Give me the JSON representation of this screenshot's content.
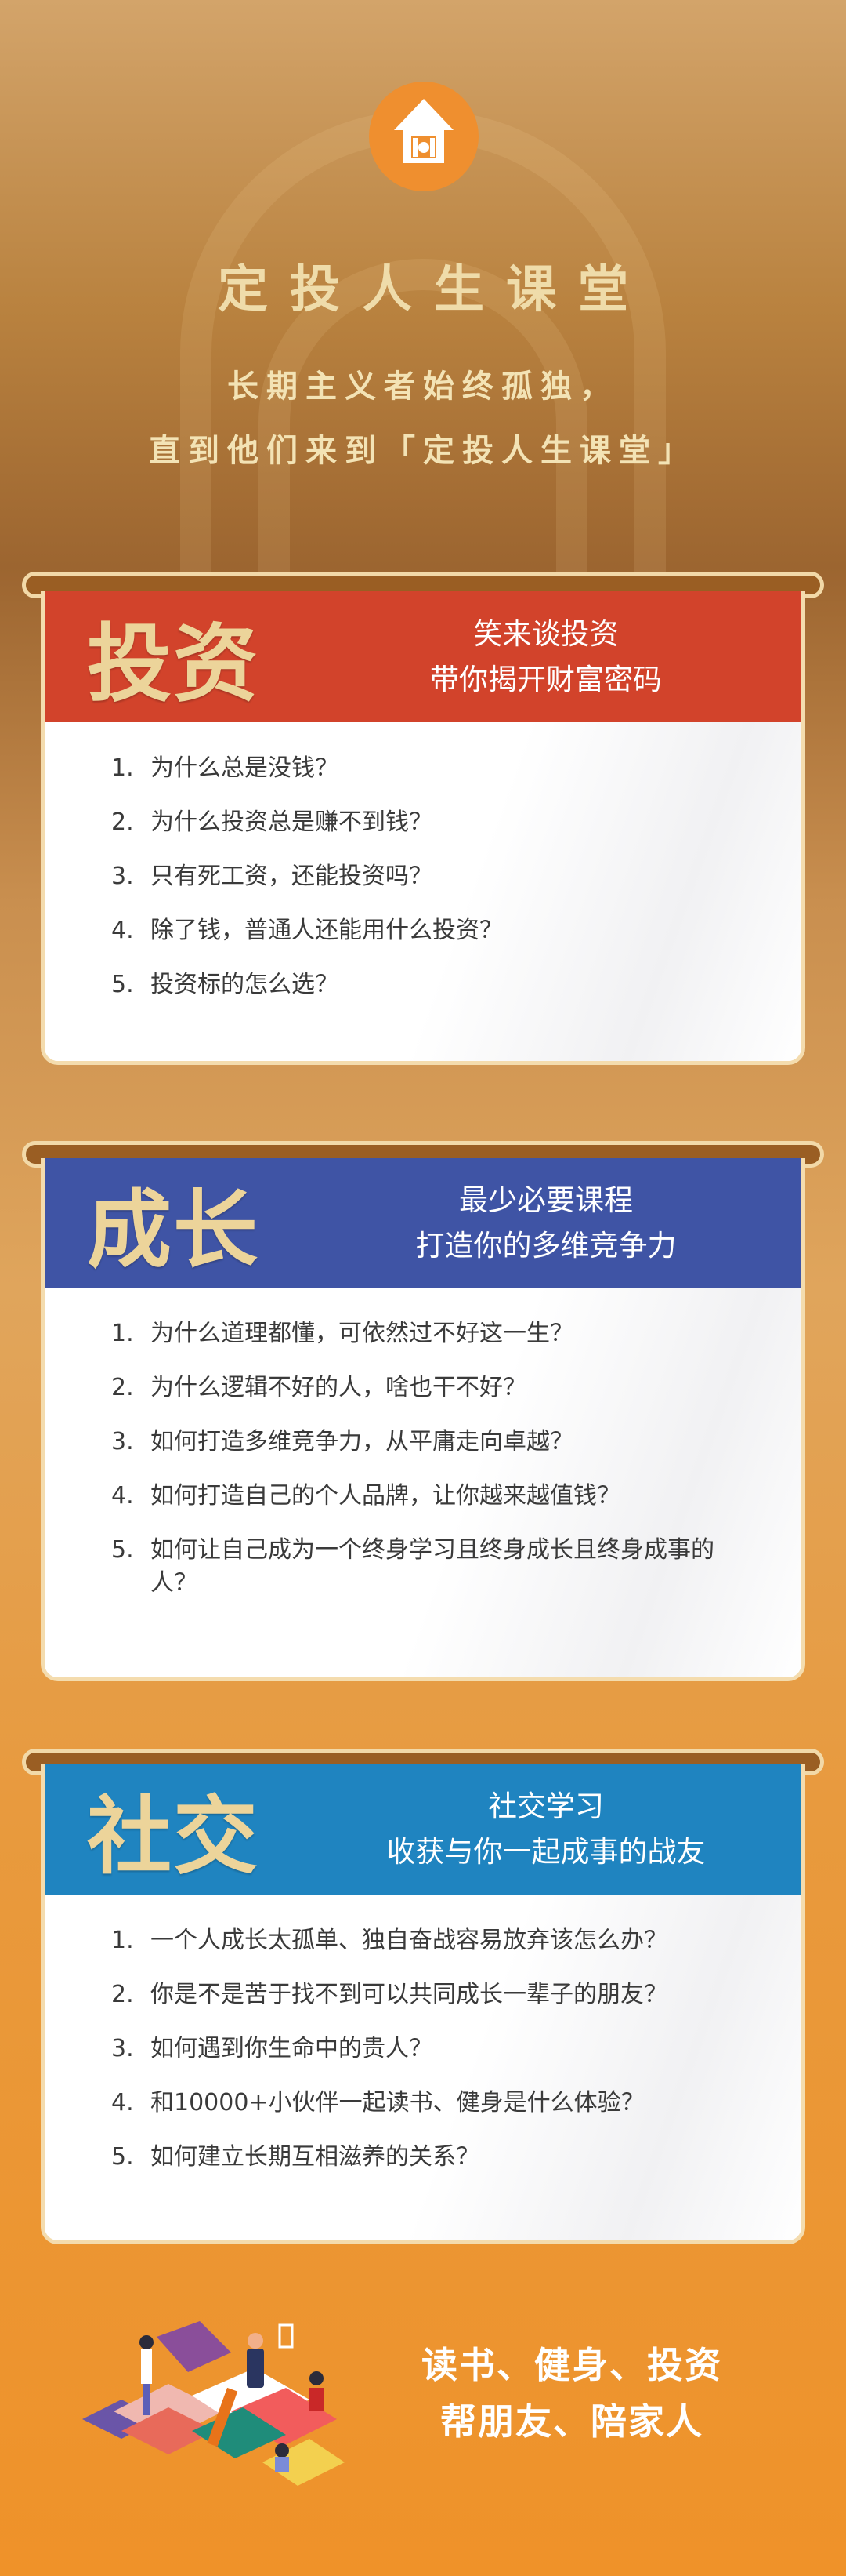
{
  "header": {
    "logo_icon": "house-coin-icon",
    "title": "定投人生课堂",
    "subtitle_lines": [
      "长期主义者始终孤独，",
      "直到他们来到「定投人生课堂」"
    ]
  },
  "cards": [
    {
      "title": "投资",
      "tagline": [
        "笑来谈投资",
        "带你揭开财富密码"
      ],
      "color": "#d2432b",
      "items": [
        "为什么总是没钱？",
        "为什么投资总是赚不到钱？",
        "只有死工资，还能投资吗？",
        "除了钱，普通人还能用什么投资？",
        "投资标的怎么选？"
      ]
    },
    {
      "title": "成长",
      "tagline": [
        "最少必要课程",
        "打造你的多维竞争力"
      ],
      "color": "#3f54a5",
      "items": [
        "为什么道理都懂，可依然过不好这一生？",
        "为什么逻辑不好的人，啥也干不好？",
        "如何打造多维竞争力，从平庸走向卓越？",
        "如何打造自己的个人品牌，让你越来越值钱？",
        "如何让自己成为一个终身学习且终身成长且终身成事的人？"
      ]
    },
    {
      "title": "社交",
      "tagline": [
        "社交学习",
        "收获与你一起成事的战友"
      ],
      "color": "#1f84c0",
      "items": [
        "一个人成长太孤单、独自奋战容易放弃该怎么办？",
        "你是不是苦于找不到可以共同成长一辈子的朋友？",
        "如何遇到你生命中的贵人？",
        "和10000+小伙伴一起读书、健身是什么体验？",
        "如何建立长期互相滋养的关系？"
      ]
    }
  ],
  "footer": {
    "illustration": "people-reading-books-illustration",
    "lines": [
      "读书、健身、投资",
      "帮朋友、陪家人"
    ]
  }
}
